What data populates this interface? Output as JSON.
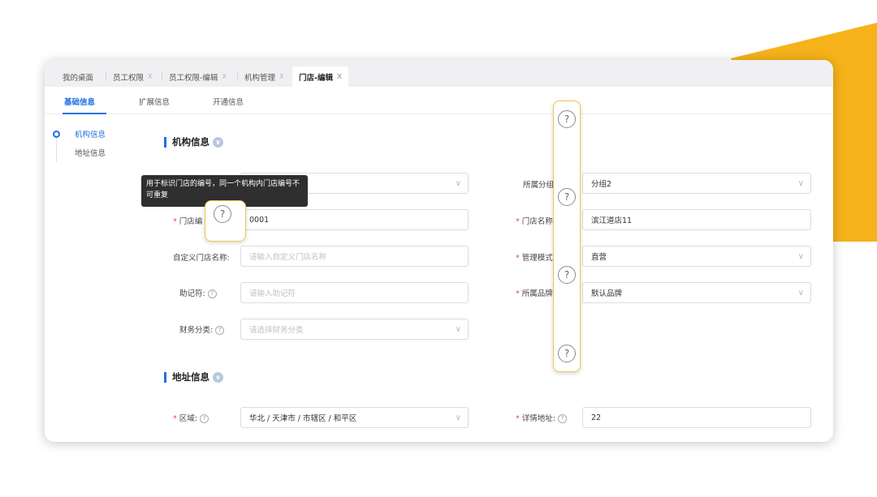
{
  "colors": {
    "accent": "#f5b21a",
    "primary": "#1d6fe0",
    "required": "#e5484d"
  },
  "tabs": [
    {
      "label": "我的桌面",
      "closable": false
    },
    {
      "label": "员工权限",
      "closable": true,
      "close": "X"
    },
    {
      "label": "员工权限-编辑",
      "closable": true,
      "close": "X"
    },
    {
      "label": "机构管理",
      "closable": true,
      "close": "X"
    },
    {
      "label": "门店-编辑",
      "closable": true,
      "close": "X",
      "active": true
    }
  ],
  "subtabs": [
    "基础信息",
    "扩展信息",
    "开通信息"
  ],
  "leftnav": [
    "机构信息",
    "地址信息"
  ],
  "sections": {
    "org": "机构信息",
    "address": "地址信息"
  },
  "tooltip": {
    "text": "用于标识门店的编号，同一个机构内门店编号不可重复"
  },
  "required_mark": "*",
  "help_glyph": "?",
  "chevron": "∨",
  "form": {
    "store_code": {
      "label": "门店编",
      "value": "0001"
    },
    "custom_name": {
      "label": "自定义门店名称:",
      "placeholder": "请输入自定义门店名称"
    },
    "mnemonic": {
      "label": "助记符:",
      "placeholder": "请输入助记符"
    },
    "finance": {
      "label": "财务分类:",
      "placeholder": "请选择财务分类"
    },
    "group": {
      "label": "所属分组",
      "value": "分组2"
    },
    "store_name": {
      "label": "门店名称",
      "value": "滨江道店11"
    },
    "mode": {
      "label": "管理模式",
      "value": "直营"
    },
    "brand": {
      "label": "所属品牌",
      "value": "默认品牌"
    },
    "region": {
      "label": "区域:",
      "value": "华北 / 天津市 / 市辖区 / 和平区"
    },
    "address": {
      "label": "详情地址:",
      "value": "22"
    }
  }
}
